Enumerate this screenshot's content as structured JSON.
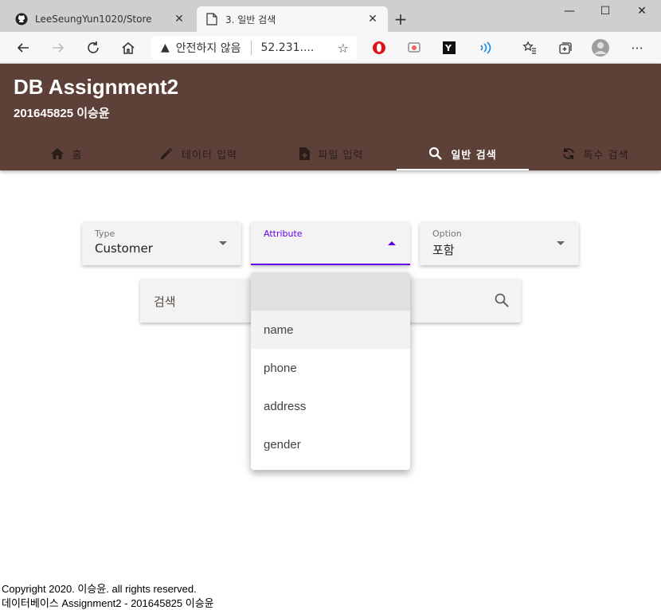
{
  "browser": {
    "tabs": [
      {
        "title": "LeeSeungYun1020/Store",
        "icon": "github-icon"
      },
      {
        "title": "3. 일반 검색",
        "icon": "page-icon"
      }
    ],
    "address": {
      "warning": "안전하지 않음",
      "url": "52.231...."
    },
    "window_controls": {
      "minimize": "—",
      "maximize": "☐",
      "close": "✕"
    }
  },
  "app": {
    "title": "DB Assignment2",
    "subtitle": "201645825 이승윤",
    "nav": [
      {
        "label": "홈",
        "icon": "home-icon"
      },
      {
        "label": "데이터 입력",
        "icon": "pencil-icon"
      },
      {
        "label": "파일 입력",
        "icon": "file-add-icon"
      },
      {
        "label": "일반 검색",
        "icon": "search-icon",
        "active": true
      },
      {
        "label": "특수 검색",
        "icon": "refresh-icon"
      }
    ],
    "accent_color": "#5d4037",
    "focus_color": "#6200ee"
  },
  "form": {
    "type": {
      "label": "Type",
      "value": "Customer"
    },
    "attribute": {
      "label": "Attribute",
      "value": ""
    },
    "option": {
      "label": "Option",
      "value": "포함"
    },
    "search_placeholder": "검색"
  },
  "attribute_menu": {
    "items": [
      "",
      "name",
      "phone",
      "address",
      "gender"
    ]
  },
  "footer": {
    "line1": "Copyright 2020. 이승윤. all rights reserved.",
    "line2": "데이터베이스 Assignment2 - 201645825 이승윤"
  }
}
